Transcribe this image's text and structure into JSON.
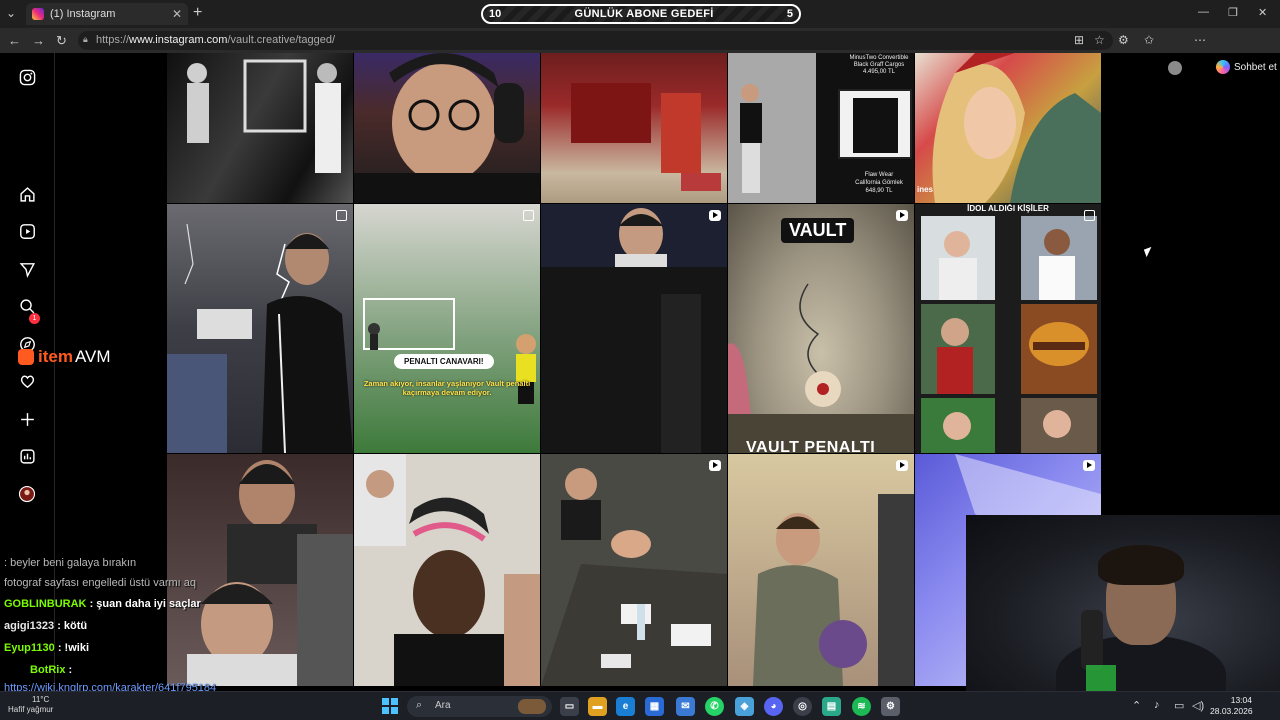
{
  "browser": {
    "tab_title": "(1) Instagram",
    "tab_close": "✕",
    "new_tab": "+",
    "url_prefix": "https://",
    "url_host": "www.instagram.com",
    "url_path": "/vault.creative/tagged/",
    "copilot_label": "Sohbet et",
    "window_controls": [
      "—",
      "❐",
      "✕"
    ]
  },
  "overlay_goal": {
    "left_number": "10",
    "title": "GÜNLÜK ABONE GEDEFİ",
    "right_number": "5"
  },
  "instagram": {
    "sidebar_badge": "1",
    "sidebar_icons": [
      "instagram-logo-icon",
      "home-icon",
      "reels-icon",
      "messages-icon",
      "search-icon",
      "explore-icon",
      "notifications-icon",
      "create-icon",
      "dashboard-icon",
      "profile-icon"
    ],
    "tiles": {
      "t4_lines": [
        "MinusTwo Convertible",
        "Black Graff Cargos",
        "4.495,00 TL"
      ],
      "t4_bottom": [
        "Flaw Wear",
        "California Gömlek",
        "648,90 TL"
      ],
      "t5_text": "ines",
      "t10_header": "İDOL ALDIĞI KİŞİLER",
      "penalti_pill": "PENALTI CANAVARI!",
      "penalti_sub": "Zaman akıyor, insanlar yaşlanıyor Vault penaltı kaçırmaya devam ediyor.",
      "vault_word": "VAULT",
      "vault_penalti": "VAULT PENALTI"
    }
  },
  "brand_overlay": {
    "left": "item",
    "right": "AVM"
  },
  "chat": [
    {
      "user": "",
      "msg": ": beyler beni galaya bırakın",
      "dim": true
    },
    {
      "user": "",
      "msg": "fotograf sayfası engelledi üstü varmı aq",
      "dim": true
    },
    {
      "user": "GOBLINBURAK",
      "msg": ": şuan daha iyi saçlar"
    },
    {
      "user": "agigi1323",
      "msg": ": kötü"
    },
    {
      "user": "Eyup1130",
      "msg": ": !wiki"
    },
    {
      "user": "BotRix",
      "msg": ":"
    },
    {
      "user": "",
      "msg": "https://wiki.knglrp.com/karakter/641f795184",
      "link": true
    }
  ],
  "taskbar": {
    "weather_temp": "11°C",
    "weather_desc": "Hafif yağmur",
    "search_placeholder": "Ara",
    "time": "13:04",
    "date": "28.03.2026"
  },
  "colors": {
    "accent_blue": "#4cc2ff",
    "itemavm_orange": "#ff5a1f",
    "notification_red": "#ff3040",
    "chat_green": "#7cfc00"
  }
}
